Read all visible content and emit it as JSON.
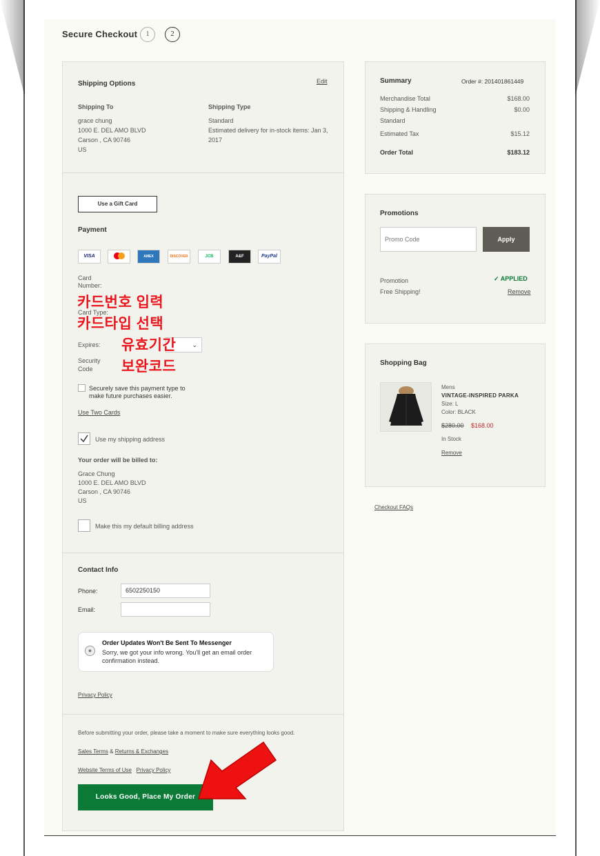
{
  "header": {
    "title": "Secure Checkout",
    "step1": "1",
    "step2": "2"
  },
  "shipping": {
    "heading": "Shipping Options",
    "edit": "Edit",
    "to_label": "Shipping To",
    "to_lines": [
      "grace chung",
      "1000 E. DEL AMO BLVD",
      "Carson , CA 90746",
      "US"
    ],
    "type_label": "Shipping Type",
    "type_value": "Standard",
    "estimate": "Estimated delivery for in-stock items: Jan 3, 2017"
  },
  "payment": {
    "gift_card": "Use a Gift Card",
    "heading": "Payment",
    "cards": [
      "VISA",
      "MC",
      "AMEX",
      "DISCOVER",
      "JCB",
      "A&F",
      "PayPal"
    ],
    "card_number_label": "Card Number:",
    "card_type_label": "Card Type:",
    "expires_label": "Expires:",
    "security_label": "Security Code",
    "save_text": "Securely save this payment type to make future purchases easier.",
    "two_cards": "Use Two Cards",
    "use_shipping": "Use my shipping address",
    "billed_heading": "Your order will be billed to:",
    "billed_lines": [
      "Grace Chung",
      "1000 E. DEL AMO BLVD",
      "Carson , CA 90746",
      "US"
    ],
    "default_billing": "Make this my default billing address"
  },
  "annotations": {
    "card_number": "카드번호 입력",
    "card_type": "카드타입 선택",
    "expires": "유효기간",
    "security": "보완코드"
  },
  "contact": {
    "heading": "Contact Info",
    "phone_label": "Phone:",
    "phone_value": "6502250150",
    "email_label": "Email:",
    "email_value": "",
    "notice_title": "Order Updates Won't Be Sent To Messenger",
    "notice_body": "Sorry, we got your info wrong. You'll get an email order confirmation instead.",
    "privacy": "Privacy Policy"
  },
  "submit": {
    "note": "Before submitting your order, please take a moment to make sure everything looks good.",
    "sales_terms": "Sales Terms",
    "amp": "&",
    "returns": "Returns & Exchanges",
    "website_terms": "Website Terms of Use",
    "privacy": "Privacy Policy",
    "place_order": "Looks Good, Place My Order"
  },
  "summary": {
    "heading": "Summary",
    "order_no": "Order #: 201401861449",
    "rows": [
      {
        "label": "Merchandise Total",
        "value": "$168.00"
      },
      {
        "label": "Shipping & Handling",
        "value": "$0.00"
      },
      {
        "label": "Standard",
        "value": ""
      },
      {
        "label": "Estimated Tax",
        "value": "$15.12"
      }
    ],
    "total_label": "Order Total",
    "total_value": "$183.12"
  },
  "promotions": {
    "heading": "Promotions",
    "placeholder": "Promo Code",
    "apply": "Apply",
    "promo_label": "Promotion",
    "applied": "APPLIED",
    "promo_name": "Free Shipping!",
    "remove": "Remove"
  },
  "bag": {
    "heading": "Shopping Bag",
    "category": "Mens",
    "name": "VINTAGE-INSPIRED PARKA",
    "size": "Size: L",
    "color": "Color: BLACK",
    "old_price": "$280.00",
    "price": "$168.00",
    "stock": "In Stock",
    "remove": "Remove"
  },
  "faq": "Checkout FAQs",
  "colors": {
    "accent_green": "#0b7a36",
    "sale_red": "#c0262c",
    "annotation_red": "#e8151b"
  }
}
